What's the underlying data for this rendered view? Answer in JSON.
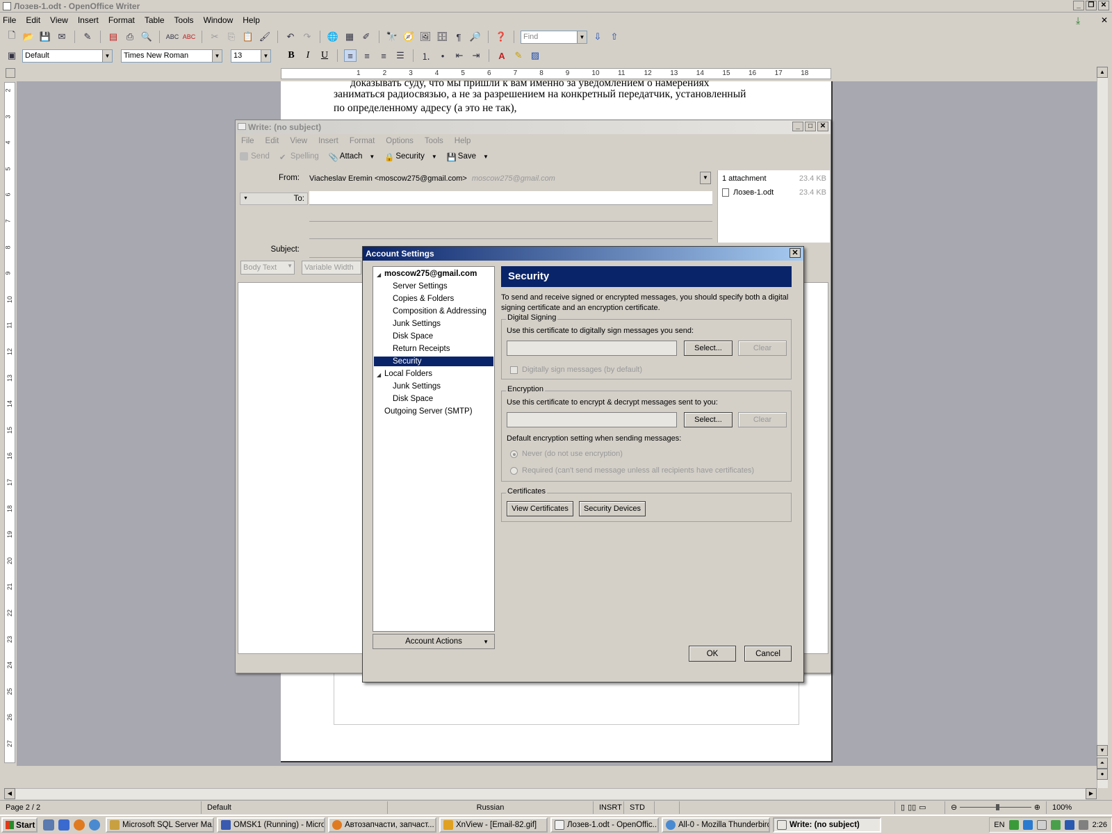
{
  "main_window": {
    "title": "Лозев-1.odt - OpenOffice Writer",
    "menu": [
      "File",
      "Edit",
      "View",
      "Insert",
      "Format",
      "Table",
      "Tools",
      "Window",
      "Help"
    ],
    "find_placeholder": "Find",
    "paragraph_style": "Default",
    "font_name": "Times New Roman",
    "font_size": "13",
    "format_buttons": [
      "B",
      "I",
      "U"
    ]
  },
  "document": {
    "lines": [
      "доказывать суду, что мы пришли к вам именно за уведомлением о намерениях",
      "заниматься радиосвязью, а не за разрешением на конкретный передатчик, установленный",
      "по определенному адресу (а это не так),"
    ]
  },
  "ruler": {
    "h_numbers": [
      "1",
      "2",
      "3",
      "4",
      "5",
      "6",
      "7",
      "8",
      "9",
      "10",
      "11",
      "12",
      "13",
      "14",
      "15",
      "16",
      "17",
      "18"
    ],
    "v_numbers": [
      "2",
      "3",
      "4",
      "5",
      "6",
      "7",
      "8",
      "9",
      "10",
      "11",
      "12",
      "13",
      "14",
      "15",
      "16",
      "17",
      "18",
      "19",
      "20",
      "21",
      "22",
      "23",
      "24",
      "25",
      "26",
      "27"
    ]
  },
  "status_bar": {
    "page": "Page 2 / 2",
    "style": "Default",
    "language": "Russian",
    "insert_mode": "INSRT",
    "selection_mode": "STD",
    "zoom": "100%"
  },
  "compose": {
    "title": "Write: (no subject)",
    "menu": [
      "File",
      "Edit",
      "View",
      "Insert",
      "Format",
      "Options",
      "Tools",
      "Help"
    ],
    "toolbar": {
      "send": "Send",
      "spelling": "Spelling",
      "attach": "Attach",
      "security": "Security",
      "save": "Save"
    },
    "from_label": "From:",
    "from_value": "Viacheslav Eremin <moscow275@gmail.com>",
    "from_address_hint": "moscow275@gmail.com",
    "to_label": "To:",
    "subject_label": "Subject:",
    "attachments_header": "1 attachment",
    "attachments_total_size": "23.4 KB",
    "attachment_name": "Лозев-1.odt",
    "attachment_size": "23.4 KB",
    "body_format": "Body Text",
    "font_width": "Variable Width"
  },
  "account_settings": {
    "title": "Account Settings",
    "tree": {
      "account": "moscow275@gmail.com",
      "account_items": [
        "Server Settings",
        "Copies & Folders",
        "Composition & Addressing",
        "Junk Settings",
        "Disk Space",
        "Return Receipts",
        "Security"
      ],
      "local_folders": "Local Folders",
      "local_items": [
        "Junk Settings",
        "Disk Space"
      ],
      "outgoing": "Outgoing Server (SMTP)"
    },
    "account_actions": "Account Actions",
    "pane_title": "Security",
    "intro": "To send and receive signed or encrypted messages, you should specify both a digital signing certificate and an encryption certificate.",
    "digital_signing": {
      "title": "Digital Signing",
      "label": "Use this certificate to digitally sign messages you send:",
      "select": "Select...",
      "clear": "Clear",
      "checkbox": "Digitally sign messages (by default)"
    },
    "encryption": {
      "title": "Encryption",
      "label": "Use this certificate to encrypt & decrypt messages sent to you:",
      "select": "Select...",
      "clear": "Clear",
      "default_label": "Default encryption setting when sending messages:",
      "never": "Never (do not use encryption)",
      "required": "Required (can't send message unless all recipients have certificates)"
    },
    "certificates": {
      "title": "Certificates",
      "view": "View Certificates",
      "devices": "Security Devices"
    },
    "ok": "OK",
    "cancel": "Cancel"
  },
  "taskbar": {
    "start": "Start",
    "tasks": [
      "Microsoft SQL Server Ma...",
      "OMSK1 (Running) - Micro...",
      "Автозапчасти, запчаст...",
      "XnView - [Email-82.gif]",
      "Лозев-1.odt - OpenOffic...",
      "All-0 - Mozilla Thunderbird",
      "Write: (no subject)"
    ],
    "lang": "EN",
    "clock": "2:26"
  }
}
